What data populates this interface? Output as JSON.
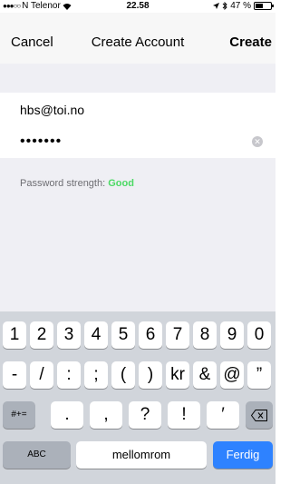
{
  "status": {
    "carrier": "N Telenor",
    "time": "22.58",
    "battery_text": "47 %",
    "battery_level": 0.47,
    "signal_icon": "signal-dots-icon",
    "wifi_icon": "wifi-icon"
  },
  "nav": {
    "cancel": "Cancel",
    "title": "Create Account",
    "create": "Create"
  },
  "form": {
    "email_value": "hbs@toi.no",
    "password_value": "•••••••",
    "strength_label": "Password strength:",
    "strength_value": "Good"
  },
  "keyboard": {
    "row1": [
      "1",
      "2",
      "3",
      "4",
      "5",
      "6",
      "7",
      "8",
      "9",
      "0"
    ],
    "row2": [
      "-",
      "/",
      ":",
      ";",
      "(",
      ")",
      "kr",
      "&",
      "@",
      "”"
    ],
    "row3": [
      "#+=",
      ".",
      ",",
      "?",
      "!",
      "′"
    ],
    "row4": [
      "ABC",
      "mellomrom",
      "Ferdig"
    ]
  },
  "colors": {
    "accent": "#2e82ff",
    "strength_good": "#4cd964"
  }
}
